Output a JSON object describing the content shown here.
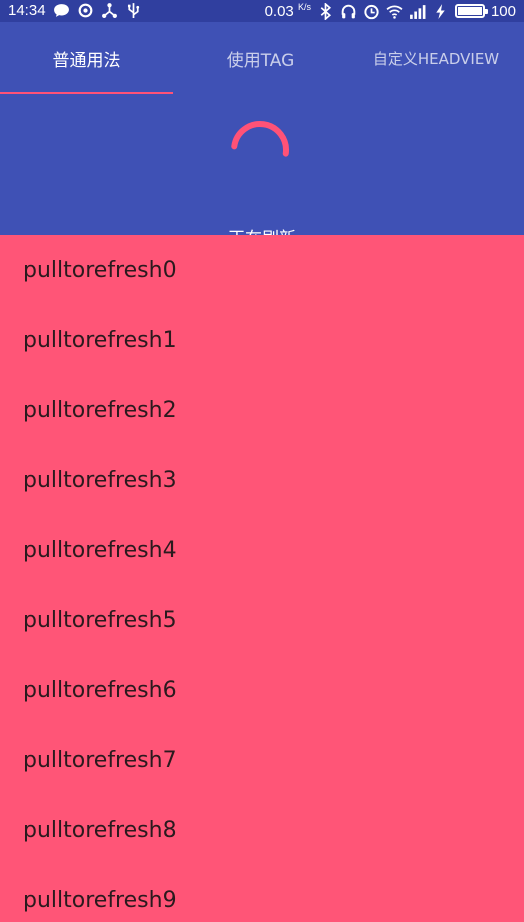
{
  "status_bar": {
    "time": "14:34",
    "speed_value": "0.03",
    "speed_unit": "K/s",
    "battery_level": "100",
    "icons_left": [
      "chat-bubble-icon",
      "sync-icon",
      "share-icon",
      "usb-icon"
    ],
    "icons_right": [
      "bluetooth-icon",
      "headset-icon",
      "alarm-icon",
      "wifi-icon",
      "signal-icon",
      "charging-icon"
    ]
  },
  "tabs": [
    {
      "label": "普通用法",
      "active": true
    },
    {
      "label": "使用TAG",
      "active": false
    },
    {
      "label": "自定义HEADVIEW",
      "active": false
    }
  ],
  "refresh": {
    "text": "正在刷新",
    "spinner_color": "#ff5277"
  },
  "list": {
    "items": [
      "pulltorefresh0",
      "pulltorefresh1",
      "pulltorefresh2",
      "pulltorefresh3",
      "pulltorefresh4",
      "pulltorefresh5",
      "pulltorefresh6",
      "pulltorefresh7",
      "pulltorefresh8",
      "pulltorefresh9"
    ]
  },
  "colors": {
    "primary": "#3f51b5",
    "primary_dark": "#303f9f",
    "accent": "#ff5277",
    "list_background": "#ff5577"
  }
}
